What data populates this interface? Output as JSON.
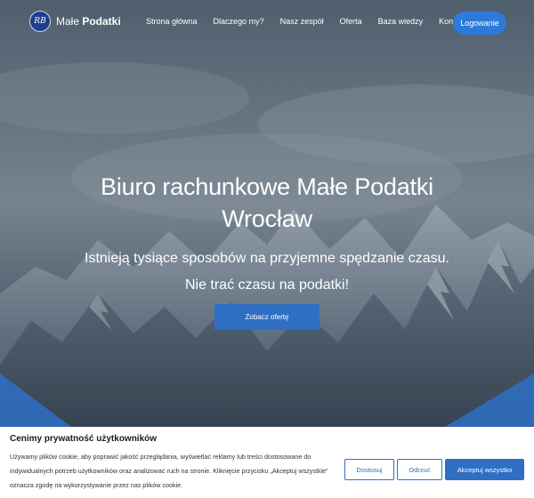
{
  "brand": {
    "logo_initials": "RB",
    "name_light": "Małe ",
    "name_bold": "Podatki"
  },
  "nav": {
    "items": [
      {
        "label": "Strona główna"
      },
      {
        "label": "Dlaczego my?"
      },
      {
        "label": "Nasz zespół"
      },
      {
        "label": "Oferta"
      },
      {
        "label": "Baza wiedzy"
      },
      {
        "label": "Kontakt"
      }
    ],
    "login_label": "Logowanie"
  },
  "hero": {
    "title_line1": "Biuro rachunkowe Małe Podatki",
    "title_line2": "Wrocław",
    "subtitle_line1": "Istnieją tysiące sposobów na przyjemne spędzanie czasu.",
    "subtitle_line2": "Nie trać czasu na podatki!",
    "cta_label": "Zobacz ofertę"
  },
  "cookie": {
    "title": "Cenimy prywatność użytkowników",
    "text": "Używamy plików cookie, aby poprawić jakość przeglądania, wyświetlać reklamy lub treści dostosowane do indywidualnych potrzeb użytkowników oraz analizować ruch na stronie. Kliknięcie przycisku „Akceptuj wszystkie” oznacza zgodę na wykorzystywanie przez nas plików cookie.",
    "customize_label": "Dostosuj",
    "reject_label": "Odrzuć",
    "accept_label": "Akceptuj wszystko"
  },
  "colors": {
    "accent": "#2e6fc4",
    "login_button": "#2e7ad9",
    "hero_overlay": "#3c4a58",
    "triangle_blue": "#2e6fc4"
  }
}
